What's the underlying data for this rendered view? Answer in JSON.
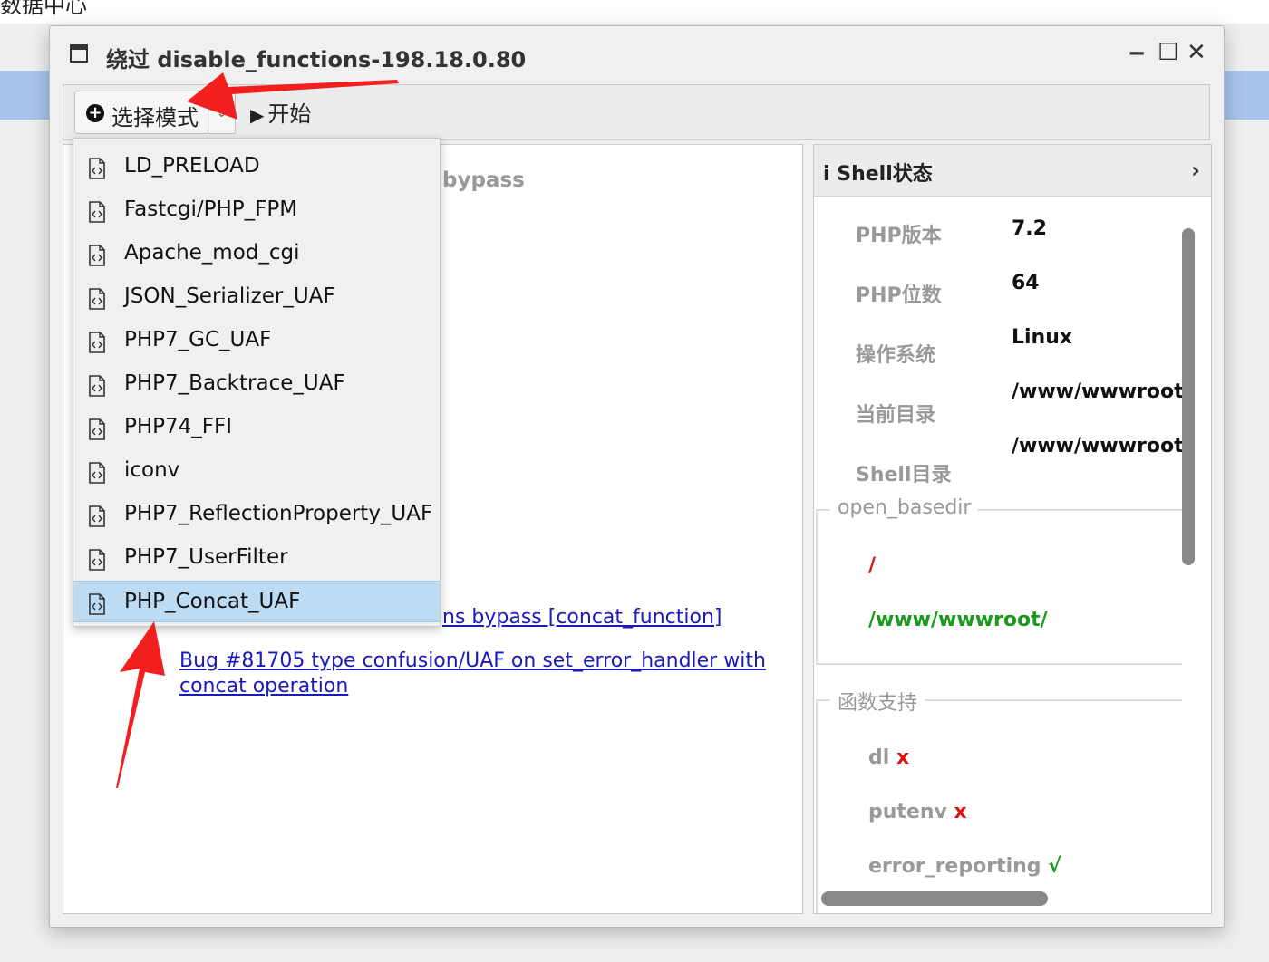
{
  "background": {
    "title": "数据中心"
  },
  "window": {
    "title": "绕过 disable_functions-198.18.0.80",
    "controls": {
      "minimize": "‒",
      "maximize": "☐",
      "close": "✕"
    }
  },
  "toolbar": {
    "mode_label": "选择模式",
    "mode_dropdown_icon": "⌄",
    "start_label": "开始",
    "start_icon": "▶"
  },
  "dropdown": {
    "items": [
      "LD_PRELOAD",
      "Fastcgi/PHP_FPM",
      "Apache_mod_cgi",
      "JSON_Serializer_UAF",
      "PHP7_GC_UAF",
      "PHP7_Backtrace_UAF",
      "PHP74_FFI",
      "iconv",
      "PHP7_ReflectionProperty_UAF",
      "PHP7_UserFilter",
      "PHP_Concat_UAF"
    ],
    "selected": "PHP_Concat_UAF"
  },
  "main": {
    "bypass_text": "bypass",
    "link1": "ns bypass [concat_function]",
    "link2": "Bug #81705 type confusion/UAF on set_error_handler with concat operation"
  },
  "shell_status": {
    "title": "Shell状态",
    "info_icon": "i",
    "chevron": "›",
    "rows": [
      {
        "label": "PHP版本",
        "value": "7.2"
      },
      {
        "label": "PHP位数",
        "value": "64"
      },
      {
        "label": "操作系统",
        "value": "Linux"
      },
      {
        "label": "当前目录",
        "value": "/www/wwwroot"
      },
      {
        "label": "Shell目录",
        "value": "/www/wwwroot"
      }
    ],
    "open_basedir": {
      "legend": "open_basedir",
      "items": [
        "/",
        "/www/wwwroot/"
      ]
    },
    "functions": {
      "legend": "函数支持",
      "items": [
        {
          "name": "dl",
          "mark": "x"
        },
        {
          "name": "putenv",
          "mark": "x"
        },
        {
          "name": "error_reporting",
          "mark": "√"
        }
      ]
    }
  },
  "colors": {
    "selected_bg": "#bddcf4",
    "link": "#1a1ab8",
    "error": "#e01010",
    "ok": "#1a9a1a",
    "arrow": "#f21f1f"
  }
}
